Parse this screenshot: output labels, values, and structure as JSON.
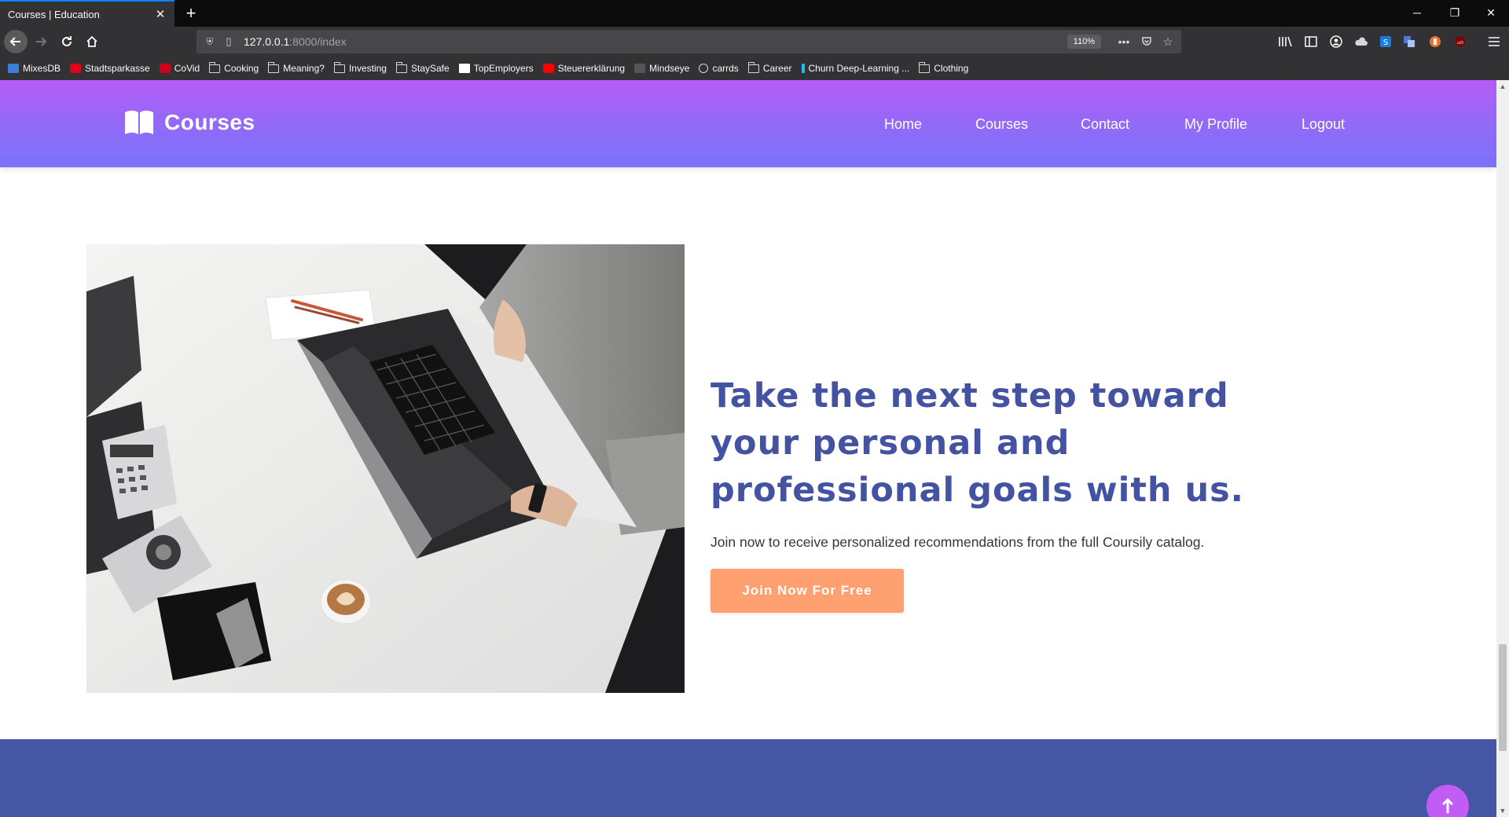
{
  "browser": {
    "tab_title": "Courses | Education",
    "tab_close": "✕",
    "new_tab": "+",
    "url_host": "127.0.0.1",
    "url_path": ":8000/index",
    "zoom": "110%",
    "window_controls": {
      "minimize": "─",
      "restore": "❐",
      "close": "✕"
    },
    "bookmarks": [
      {
        "label": "MixesDB",
        "icon": "mixesdb-icon"
      },
      {
        "label": "Stadtsparkasse",
        "icon": "sparkasse-icon"
      },
      {
        "label": "CoVid",
        "icon": "covid-icon"
      },
      {
        "label": "Cooking",
        "icon": "folder-icon"
      },
      {
        "label": "Meaning?",
        "icon": "folder-icon"
      },
      {
        "label": "Investing",
        "icon": "folder-icon"
      },
      {
        "label": "StaySafe",
        "icon": "folder-icon"
      },
      {
        "label": "TopEmployers",
        "icon": "medium-icon"
      },
      {
        "label": "Steuererklärung",
        "icon": "youtube-icon"
      },
      {
        "label": "Mindseye",
        "icon": "mindseye-icon"
      },
      {
        "label": "carrds",
        "icon": "globe-icon"
      },
      {
        "label": "Career",
        "icon": "folder-icon"
      },
      {
        "label": "Churn Deep-Learning ...",
        "icon": "kaggle-icon"
      },
      {
        "label": "Clothing",
        "icon": "folder-icon"
      }
    ]
  },
  "site": {
    "brand": "Courses",
    "nav": [
      "Home",
      "Courses",
      "Contact",
      "My Profile",
      "Logout"
    ],
    "headline": "Take the next step toward your personal and professional goals with us.",
    "subtext": "Join now to receive personalized recommendations from the full Coursily catalog.",
    "cta": "Join Now For Free",
    "scroll_top_icon": "arrow-up-icon"
  },
  "colors": {
    "header_gradient": [
      "#b55cf8",
      "#7b72f8"
    ],
    "headline": "#4453a1",
    "cta": "#ffa071",
    "footer_band": "#4556a5",
    "scroll_top": "#c15cf5"
  }
}
